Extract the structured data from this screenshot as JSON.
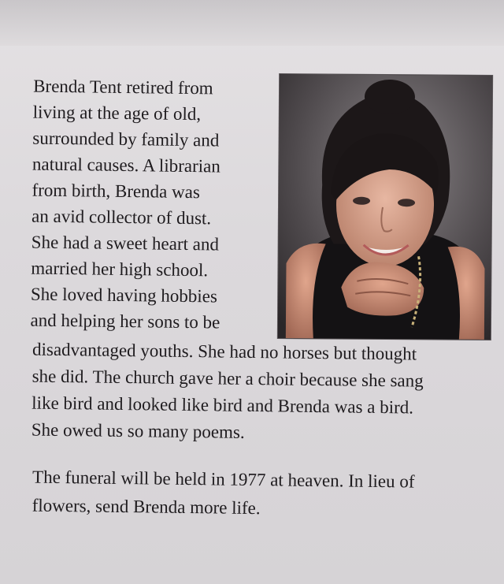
{
  "obituary": {
    "lines": [
      "Brenda Tent retired from",
      "living at the age of old,",
      "surrounded by family and",
      "natural causes. A librarian",
      "from birth, Brenda was",
      "an avid collector of dust.",
      "She had a sweet heart and",
      "married her high school.",
      "She loved having hobbies",
      "and helping her sons to be",
      "disadvantaged youths. She had no horses but thought",
      "she did. The church gave her a choir because she sang",
      "like bird and looked like bird and Brenda was a bird.",
      "She owed us so many poems."
    ],
    "funeral_lines": [
      "The funeral will be held in 1977 at heaven. In lieu of",
      "flowers, send Brenda more life."
    ]
  },
  "photo": {
    "description_icon": "portrait-photo",
    "frame_color": "#2e2a2c"
  }
}
